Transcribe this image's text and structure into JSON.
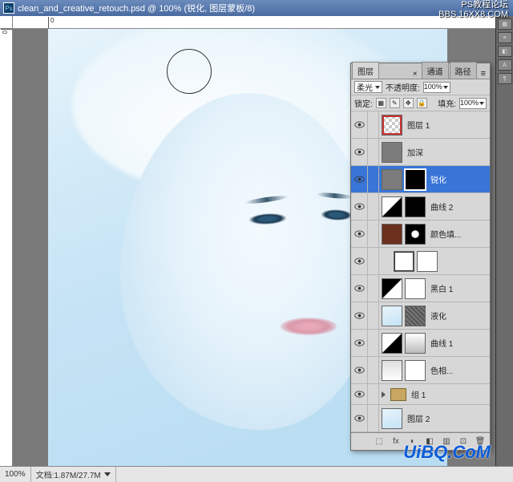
{
  "title": "clean_and_creative_retouch.psd @ 100% (锐化, 图层蒙板/8)",
  "ps_icon_label": "Ps",
  "ruler_top_marks": [
    "0"
  ],
  "ruler_left_marks": [
    "0"
  ],
  "status": {
    "zoom": "100%",
    "docinfo": "文档:1.87M/27.7M"
  },
  "panel": {
    "tabs": [
      "图层",
      "通道",
      "路径"
    ],
    "blend_mode": "柔光",
    "opacity_label": "不透明度:",
    "opacity_value": "100%",
    "lock_label": "锁定:",
    "fill_label": "填充:",
    "fill_value": "100%"
  },
  "layers": [
    {
      "name": "图层 1",
      "thumbs": [
        "checker-red"
      ],
      "sel": false
    },
    {
      "name": "加深",
      "thumbs": [
        "gray"
      ],
      "sel": false
    },
    {
      "name": "锐化",
      "thumbs": [
        "gray",
        "black-sel"
      ],
      "sel": true
    },
    {
      "name": "曲线 2",
      "thumbs": [
        "curves",
        "black"
      ],
      "sel": false
    },
    {
      "name": "颜色填...",
      "thumbs": [
        "brown",
        "spot"
      ],
      "sel": false
    },
    {
      "name": "",
      "thumbs": [
        "levels",
        "white"
      ],
      "sel": false,
      "indent": true
    },
    {
      "name": "黑白 1",
      "thumbs": [
        "bwgrad",
        "white"
      ],
      "sel": false
    },
    {
      "name": "液化",
      "thumbs": [
        "face-sm",
        "noise"
      ],
      "sel": false
    },
    {
      "name": "曲线 1",
      "thumbs": [
        "curves",
        "grad2"
      ],
      "sel": false
    },
    {
      "name": "色相...",
      "thumbs": [
        "grad3",
        "white"
      ],
      "sel": false
    },
    {
      "name": "组 1",
      "thumbs": [
        "folder"
      ],
      "sel": false,
      "group": true
    },
    {
      "name": "图层 2",
      "thumbs": [
        "face-sm"
      ],
      "sel": false
    }
  ],
  "footer_icons": [
    "⬚",
    "fx",
    "◐",
    "◧",
    "▥",
    "⊡",
    "🗑"
  ],
  "watermark_tr_line1": "PS教程论坛",
  "watermark_tr_line2": "BBS.16XX8.COM",
  "watermark_br": "UiBQ.CoM"
}
